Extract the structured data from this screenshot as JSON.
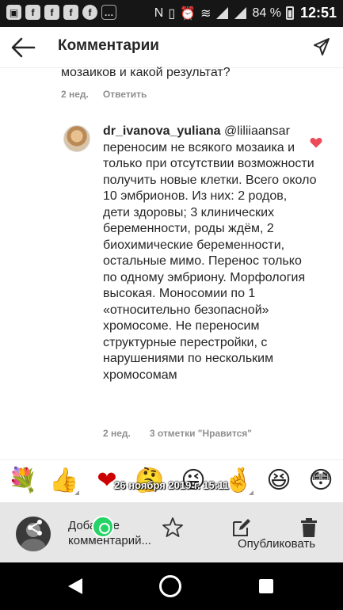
{
  "status_bar": {
    "battery": "84 %",
    "time": "12:51"
  },
  "header": {
    "title": "Комментарии"
  },
  "previous_comment": {
    "text_tail": "мозаиков и какой результат?",
    "time": "2 нед.",
    "reply_label": "Ответить"
  },
  "comment": {
    "author": "dr_ivanova_yuliana",
    "mention": "@liliiaansar",
    "text": "переносим не всякого мозаика и только при отсутствии возможности получить новые клетки. Всего около 10 эмбрионов. Из них: 2 родов, дети здоровы; 3 клинических беременности, роды ждём, 2 биохимические беременности, остальные мимо. Перенос только по одному эмбриону. Морфология высокая. Моносомии по 1 «относительно безопасной» хромосоме. Не переносим структурные перестройки, с нарушениями по нескольким хромосомам",
    "time": "2 нед.",
    "likes": "3 отметки \"Нравится\""
  },
  "emoji_bar": {
    "emojis": [
      {
        "char": "💐",
        "name": "bouquet"
      },
      {
        "char": "👍",
        "name": "thumbs-up"
      },
      {
        "char": "❤",
        "name": "heart"
      },
      {
        "char": "🤔",
        "name": "thinking-face"
      },
      {
        "char": "😜",
        "name": "winking-tongue-face"
      },
      {
        "char": "🤞",
        "name": "crossed-fingers"
      },
      {
        "char": "😆",
        "name": "laughing-face"
      },
      {
        "char": "😳",
        "name": "flushed-face"
      }
    ],
    "timestamp": "26 ноября 2019 г. 15:11"
  },
  "compose": {
    "placeholder": "Добавьте комментарий...",
    "publish_label": "Опубликовать"
  },
  "colors": {
    "status_bar_bg": "#161616",
    "heart": "#ed4956",
    "compose_bg": "#e6e6e6",
    "whatsapp": "#25d366"
  }
}
